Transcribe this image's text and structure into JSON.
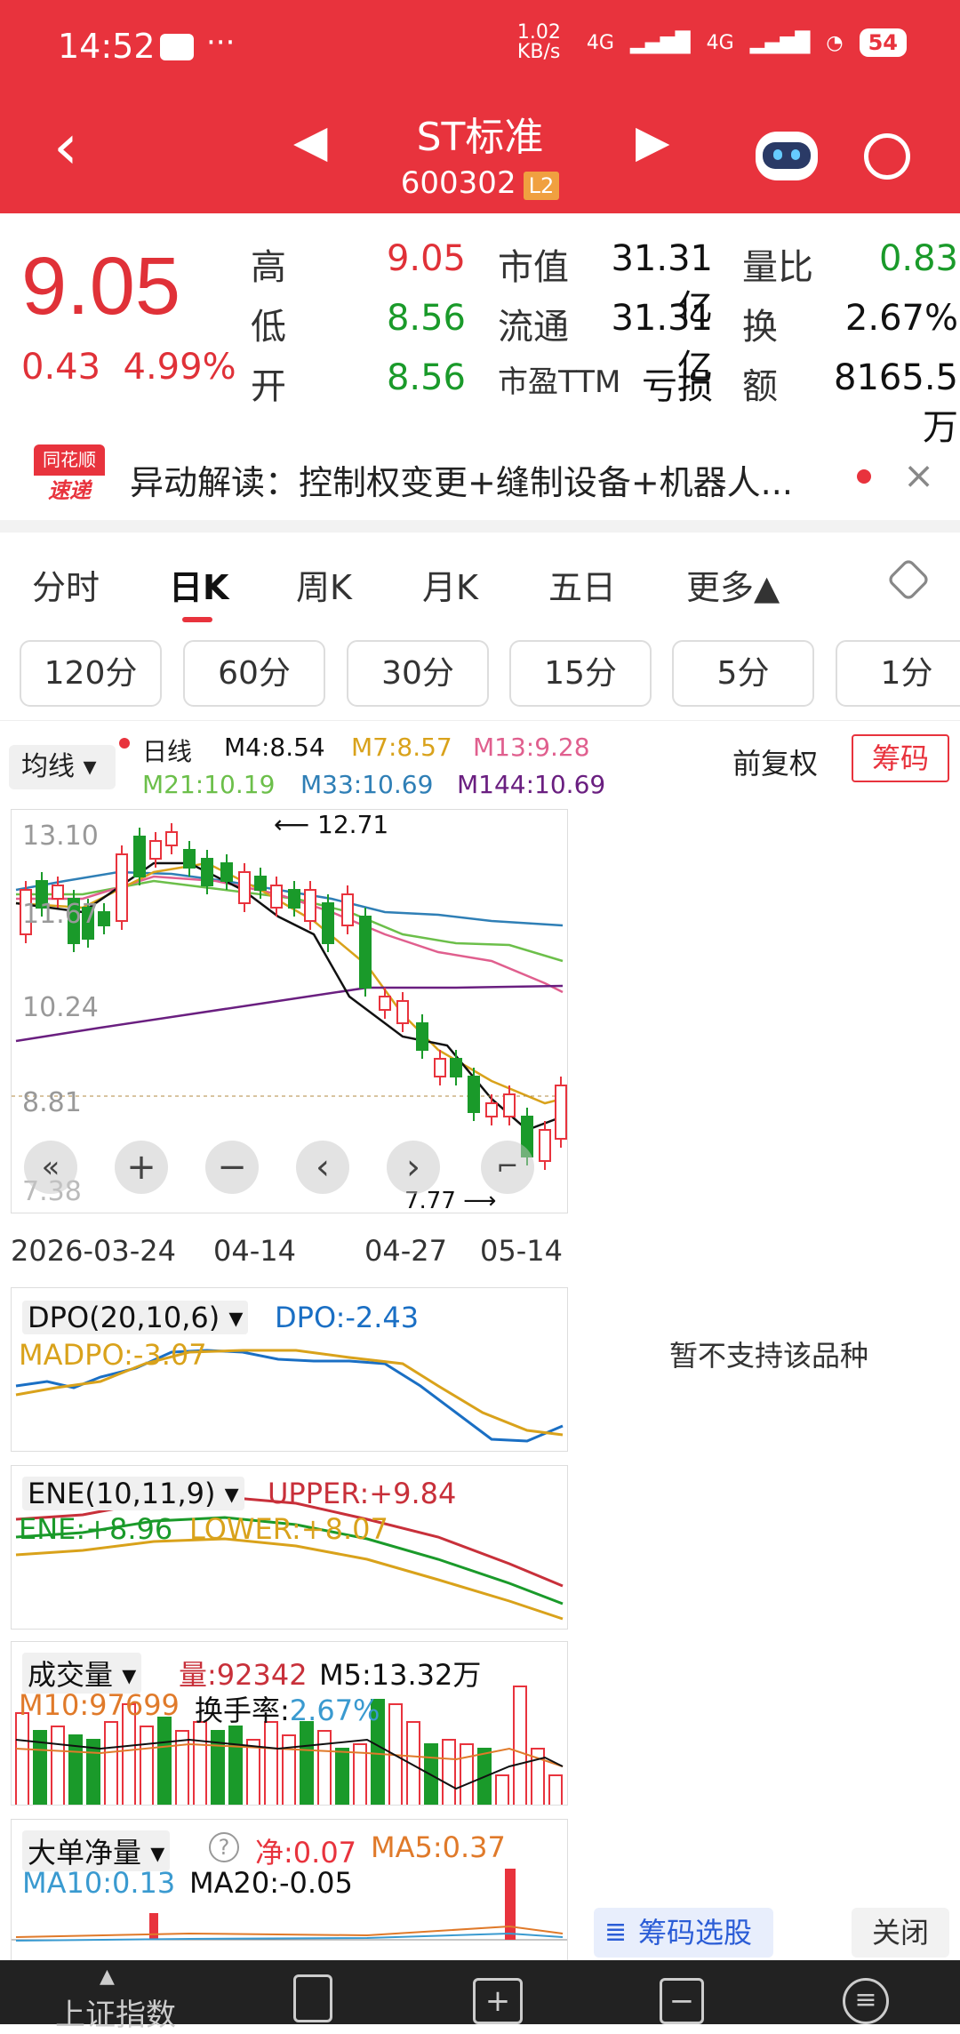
{
  "status": {
    "time": "14:52",
    "speed": "1.02 KB/s",
    "net1": "4G",
    "net2": "4G",
    "battery": "54",
    "dots": "···"
  },
  "nav": {
    "title": "ST标准",
    "code": "600302",
    "level": "L2",
    "left": "‹",
    "right": "›"
  },
  "quote": {
    "price": "9.05",
    "change": "0.43",
    "pct": "4.99%",
    "rows": [
      {
        "l1": "高",
        "v1": "9.05",
        "l2": "市值",
        "v2": "31.31亿",
        "l3": "量比",
        "v3": "0.83"
      },
      {
        "l1": "低",
        "v1": "8.56",
        "l2": "流通",
        "v2": "31.31亿",
        "l3": "换",
        "v3": "2.67%"
      },
      {
        "l1": "开",
        "v1": "8.56",
        "l2": "市盈TTM",
        "v2": "亏损",
        "l3": "额",
        "v3": "8165.5万"
      }
    ]
  },
  "news": {
    "logo1": "同花顺",
    "logo2": "速递",
    "text": "异动解读：控制权变更+缝制设备+机器人...",
    "close": "×"
  },
  "tabs": [
    "分时",
    "日K",
    "周K",
    "月K",
    "五日",
    "更多▲"
  ],
  "periods": [
    "120分",
    "60分",
    "30分",
    "15分",
    "5分",
    "1分"
  ],
  "legend": {
    "ma_btn": "均线",
    "type": "日线",
    "m4": "M4:8.54",
    "m7": "M7:8.57",
    "m13": "M13:9.28",
    "m21": "M21:10.19",
    "m33": "M33:10.69",
    "m144": "M144:10.69",
    "fq": "前复权",
    "chip": "筹码"
  },
  "kline": {
    "p1": "13.10",
    "p2": "11.67",
    "p3": "10.24",
    "p4": "8.81",
    "p5": "7.38",
    "high": "12.71",
    "low": "7.77",
    "dates": [
      "2026-03-24",
      "04-14",
      "04-27",
      "05-14"
    ],
    "marks": [
      "1",
      "2",
      "3",
      "4",
      "5",
      "6",
      "7",
      "8",
      "9"
    ]
  },
  "dpo": {
    "name": "DPO(20,10,6)",
    "dpo": "DPO:-2.43",
    "madpo": "MADPO:-3.07"
  },
  "ene": {
    "name": "ENE(10,11,9)",
    "upper": "UPPER:+9.84",
    "ene": "ENE:+8.96",
    "lower": "LOWER:+8.07"
  },
  "vol": {
    "name": "成交量",
    "qty": "量:92342",
    "m5": "M5:13.32万",
    "m10": "M10:97699",
    "hsl_l": "换手率:",
    "hsl": "2.67%"
  },
  "big": {
    "name": "大单净量",
    "net": "净:0.07",
    "ma5": "MA5:0.37",
    "ma10": "MA10:0.13",
    "ma20": "MA20:-0.05"
  },
  "side": {
    "msg": "暂不支持该品种",
    "pick": "筹码选股",
    "close": "关闭"
  },
  "bottom": {
    "first": "上证指数"
  },
  "colors": {
    "red": "#e8333d",
    "green": "#1a9a2a"
  }
}
